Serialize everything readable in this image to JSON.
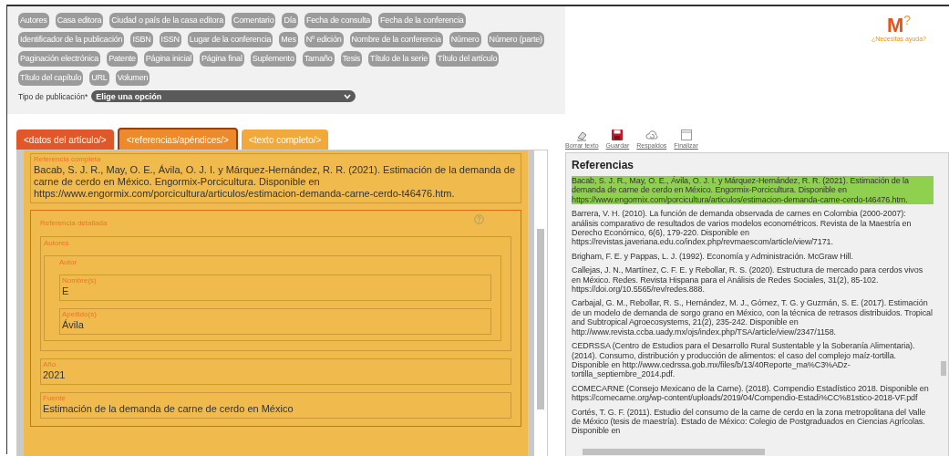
{
  "field_tags": [
    "Autores",
    "Casa editora",
    "Ciudad o país de la casa editora",
    "Comentario",
    "Día",
    "Fecha de consulta",
    "Fecha de la conferencia",
    "Identificador de la publicación",
    "ISBN",
    "ISSN",
    "Lugar de la conferencia",
    "Mes",
    "Nº edición",
    "Nombre de la conferencia",
    "Número",
    "Número (parte)",
    "Paginación electrónica",
    "Patente",
    "Página inicial",
    "Página final",
    "Suplemento",
    "Tamaño",
    "Tesis",
    "Título de la serie",
    "Título del artículo",
    "Título del capítulo",
    "URL",
    "Volumen"
  ],
  "publication_type": {
    "label": "Tipo de publicación*",
    "value": "Elige una opción"
  },
  "logo": {
    "mark": "M",
    "superscript": "?",
    "help": "¿Necesitas ayuda?"
  },
  "tabs": [
    {
      "label": "<datos del artículo/>",
      "selected": false,
      "color": "#e0572a"
    },
    {
      "label": "<referencias/apéndices/>",
      "selected": true,
      "color": "#ec8a2c"
    },
    {
      "label": "<texto completo/>",
      "selected": false,
      "color": "#f2a93c"
    }
  ],
  "editor": {
    "complete": {
      "label": "Referencia completa",
      "value": "Bacab, S. J. R., May, O. E., Ávila, O. J. I. y Márquez-Hernández, R. R. (2021). Estimación de la demanda de carne de cerdo en México. Engormix-Porcicultura. Disponible en https://www.engormix.com/porcicultura/articulos/estimacion-demanda-carne-cerdo-t46476.htm."
    },
    "detailed": {
      "label": "Referencia detallada",
      "authors": {
        "label": "Autores",
        "author": {
          "label": "Autor",
          "fields": [
            {
              "label": "Nombre(s)",
              "value": "E"
            },
            {
              "label": "Apellido(s)",
              "value": "Ávila"
            }
          ]
        }
      },
      "fields": [
        {
          "label": "Año",
          "value": "2021"
        },
        {
          "label": "Fuente",
          "value": "Estimación de la demanda de carne de cerdo en México"
        }
      ]
    }
  },
  "toolbar": [
    {
      "kind": "eraser",
      "label": "Borrar texto"
    },
    {
      "kind": "save",
      "label": "Guardar"
    },
    {
      "kind": "cloud",
      "label": "Respaldos"
    },
    {
      "kind": "window",
      "label": "Finalizar"
    }
  ],
  "references": {
    "title": "Referencias",
    "items": [
      {
        "text": "Bacab, S. J. R., May, O. E., Ávila, O. J. I. y Márquez-Hernández, R. R. (2021). Estimación de la demanda de carne de cerdo en México. Engormix-Porcicultura. Disponible en https://www.engormix.com/porcicultura/articulos/estimacion-demanda-carne-cerdo-t46476.htm.",
        "selected": true
      },
      {
        "text": "Barrera, V. H. (2010). La función de demanda observada de carnes en Colombia (2000-2007): análisis comparativo de resultados de varios modelos econométricos. Revista de la Maestría en Derecho Económico, 6(6), 179-220. Disponible en https://revistas.javeriana.edu.co/index.php/revmaescom/article/view/7171.",
        "selected": false
      },
      {
        "text": "Brigham, F. E. y Pappas, L. J. (1992). Economía y Administración. McGraw Hill.",
        "selected": false
      },
      {
        "text": "Callejas, J. N., Martínez, C. F. E. y Rebollar, R. S. (2020). Estructura de mercado para cerdos vivos en México. Redes. Revista Hispana para el Análisis de Redes Sociales, 31(2), 85-102. https://doi.org/10.5565/rev/redes.888.",
        "selected": false
      },
      {
        "text": "Carbajal, G. M., Rebollar, R. S., Hernández, M. J., Gómez, T. G. y Guzmán, S. E. (2017). Estimación de un modelo de demanda de sorgo grano en México, con la técnica de retrasos distribuidos. Tropical and Subtropical Agroecosystems, 21(2), 235-242. Disponible en http://www.revista.ccba.uady.mx/ojs/index.php/TSA/article/view/2347/1158.",
        "selected": false
      },
      {
        "text": "CEDRSSA (Centro de Estudios para el Desarrollo Rural Sustentable y la Soberanía Alimentaria). (2014). Consumo, distribución y producción de alimentos: el caso del complejo maíz-tortilla. Disponible en http://www.cedrssa.gob.mx/files/b/13/40Reporte_ma%C3%ADz-tortilla_septiembre_2014.pdf.",
        "selected": false
      },
      {
        "text": "COMECARNE (Consejo Mexicano de la Carne). (2018). Compendio Estadístico 2018. Disponible en https://comecarne.org/wp-content/uploads/2019/04/Compendio-Estadi%CC%81stico-2018-VF.pdf",
        "selected": false
      },
      {
        "text": "Cortés, T. G. F. (2011). Estudio del consumo de la carne de cerdo en la zona metropolitana del Valle de México (tesis de maestría). Estado de México: Colegio de Postgraduados en Ciencias Agrícolas. Disponible en",
        "selected": false
      }
    ]
  }
}
